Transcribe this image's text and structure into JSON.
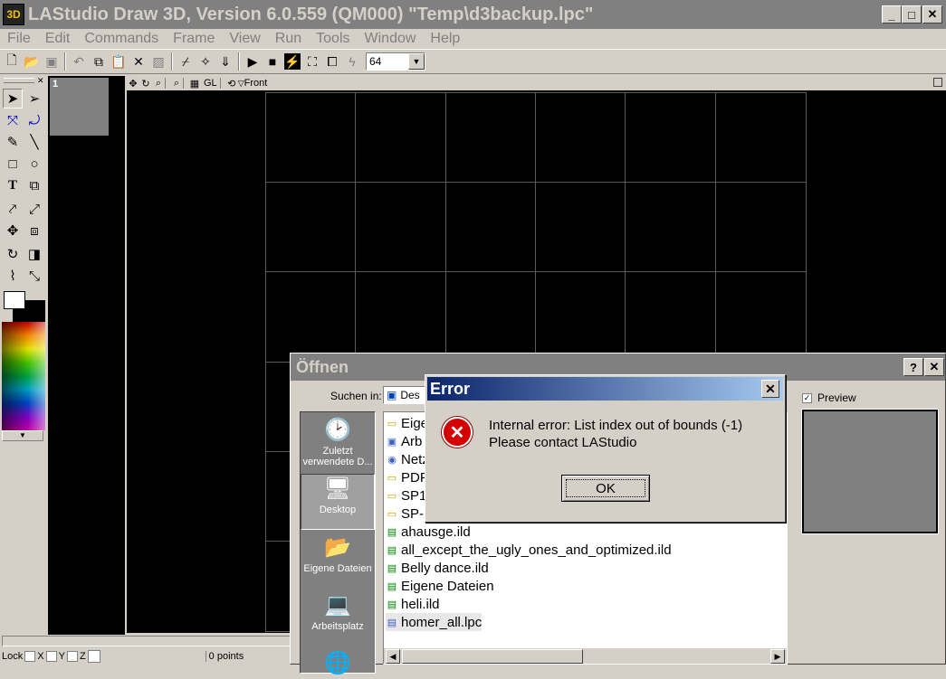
{
  "window": {
    "title": "LAStudio Draw 3D, Version 6.0.559 (QM000)  \"Temp\\d3backup.lpc\"",
    "app_icon": "3D",
    "minimize": "_",
    "maximize": "□",
    "close": "✕"
  },
  "menu": [
    "File",
    "Edit",
    "Commands",
    "Frame",
    "View",
    "Run",
    "Tools",
    "Window",
    "Help"
  ],
  "toolbar": {
    "zoom_value": "64"
  },
  "frame_thumb": {
    "label": "1"
  },
  "viewbar": {
    "gl_label": "GL",
    "view_label": "Front"
  },
  "status": {
    "lock": "Lock",
    "x": "X",
    "y": "Y",
    "z": "Z",
    "points": "0 points"
  },
  "open_dialog": {
    "title": "Öffnen",
    "help": "?",
    "close": "✕",
    "look_in_label": "Suchen in:",
    "look_in_value": "Des",
    "preview_label": "Preview",
    "places": [
      {
        "label": "Zuletzt verwendete D...",
        "icon": "recent-icon"
      },
      {
        "label": "Desktop",
        "icon": "desktop-icon"
      },
      {
        "label": "Eigene Dateien",
        "icon": "documents-icon"
      },
      {
        "label": "Arbeitsplatz",
        "icon": "computer-icon"
      }
    ],
    "files": [
      {
        "name": "Eige",
        "type": "folder"
      },
      {
        "name": "Arb",
        "type": "computer"
      },
      {
        "name": "Netz",
        "type": "network"
      },
      {
        "name": "PDF",
        "type": "folder"
      },
      {
        "name": "SP1",
        "type": "folder"
      },
      {
        "name": "SP-2",
        "type": "folder"
      },
      {
        "name": "ahausge.ild",
        "type": "ild"
      },
      {
        "name": "all_except_the_ugly_ones_and_optimized.ild",
        "type": "ild"
      },
      {
        "name": "Belly dance.ild",
        "type": "ild"
      },
      {
        "name": "Eigene Dateien",
        "type": "ild"
      },
      {
        "name": "heli.ild",
        "type": "ild"
      },
      {
        "name": "homer_all.lpc",
        "type": "lpc"
      }
    ]
  },
  "error_dialog": {
    "title": "Error",
    "close": "✕",
    "message_line1": "Internal error: List index out of bounds (-1)",
    "message_line2": "Please contact LAStudio",
    "ok_label": "OK"
  },
  "colors": {
    "title_inactive": "#808080",
    "error_title_start": "#0a246a",
    "error_title_end": "#a6caf0",
    "error_icon": "#d40000"
  }
}
